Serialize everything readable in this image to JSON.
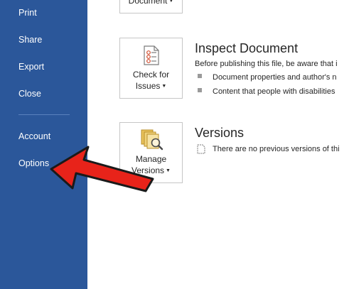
{
  "sidebar": {
    "items": [
      {
        "label": "Print"
      },
      {
        "label": "Share"
      },
      {
        "label": "Export"
      },
      {
        "label": "Close"
      },
      {
        "label": "Account"
      },
      {
        "label": "Options"
      }
    ]
  },
  "main": {
    "top_button": {
      "label": "Document"
    },
    "inspect": {
      "button_line1": "Check for",
      "button_line2": "Issues",
      "title": "Inspect Document",
      "description": "Before publishing this file, be aware that i",
      "bullets": [
        "Document properties and author's n",
        "Content that people with disabilities"
      ]
    },
    "versions": {
      "button_line1": "Manage",
      "button_line2": "Versions",
      "title": "Versions",
      "description": "There are no previous versions of thi"
    }
  },
  "colors": {
    "sidebar_bg": "#2b579a",
    "annotation_arrow": "#e8231a"
  },
  "icons": [
    "checklist-icon",
    "versions-icon",
    "document-icon",
    "red-arrow-annotation"
  ]
}
